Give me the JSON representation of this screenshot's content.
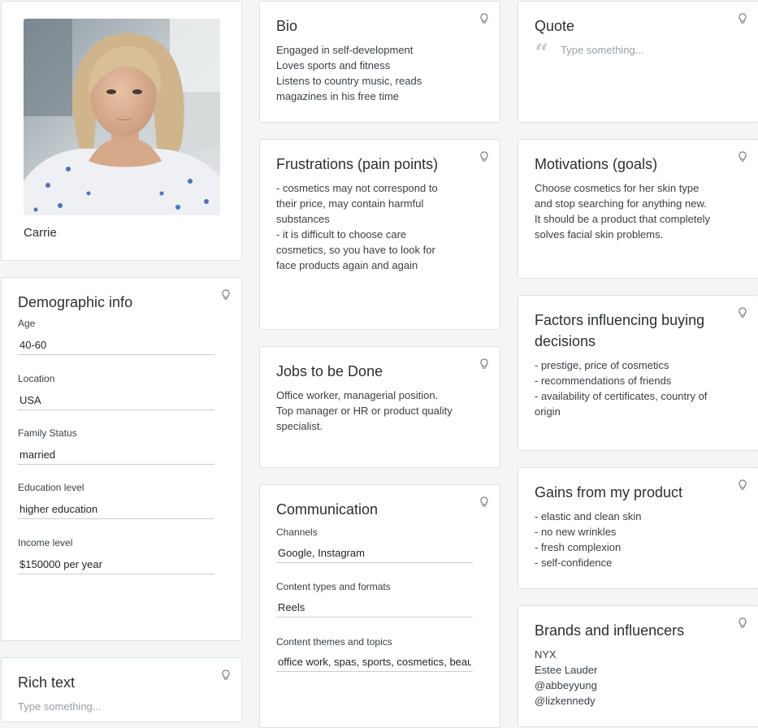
{
  "profile": {
    "name": "Carrie"
  },
  "demographic": {
    "title": "Demographic info",
    "fields": [
      {
        "label": "Age",
        "value": "40-60"
      },
      {
        "label": "Location",
        "value": "USA"
      },
      {
        "label": "Family Status",
        "value": "married"
      },
      {
        "label": "Education level",
        "value": "higher education"
      },
      {
        "label": "Income level",
        "value": "$150000 per year"
      }
    ]
  },
  "rich_text": {
    "title": "Rich text",
    "placeholder": "Type something..."
  },
  "bio": {
    "title": "Bio",
    "lines": [
      "Engaged in self-development",
      "Loves sports and fitness",
      "Listens to country music, reads",
      "magazines in his free time"
    ]
  },
  "frustrations": {
    "title": "Frustrations (pain points)",
    "lines": [
      "- cosmetics may not correspond to",
      "their price, may contain harmful",
      "substances",
      "- it is difficult to choose care",
      "cosmetics, so you have to look for",
      "face products again and again"
    ]
  },
  "jobs": {
    "title": "Jobs to be Done",
    "lines": [
      "Office worker, managerial position.",
      "Top manager or HR or product quality",
      "specialist."
    ]
  },
  "communication": {
    "title": "Communication",
    "fields": [
      {
        "label": "Channels",
        "value": "Google, Instagram"
      },
      {
        "label": "Content types and formats",
        "value": "Reels"
      },
      {
        "label": "Content themes and topics",
        "value": "office work, spas, sports, cosmetics, beauty"
      }
    ]
  },
  "quote": {
    "title": "Quote",
    "placeholder": "Type something..."
  },
  "motivations": {
    "title": "Motivations (goals)",
    "lines": [
      "Choose cosmetics for her skin type",
      "and stop searching for anything new.",
      "It should be a product that completely",
      "solves facial skin problems."
    ]
  },
  "factors": {
    "title_lines": [
      "Factors influencing buying",
      "decisions"
    ],
    "lines": [
      "- prestige, price of cosmetics",
      "- recommendations of friends",
      "- availability of certificates, country of",
      "origin"
    ]
  },
  "gains": {
    "title": "Gains from my product",
    "lines": [
      "- elastic and clean skin",
      "- no new wrinkles",
      "- fresh complexion",
      "- self-confidence"
    ]
  },
  "brands": {
    "title": "Brands and influencers",
    "lines": [
      "NYX",
      "Estee Lauder",
      "@abbeyyung",
      "@lizkennedy"
    ]
  },
  "icons": {
    "card_hint": "lightbulb-icon",
    "quote": "quote-icon"
  },
  "colors": {
    "background": "#f4f5f7",
    "card": "#ffffff",
    "border": "#dde0e4",
    "text": "#2b2f33",
    "placeholder": "#9aa0a6"
  }
}
